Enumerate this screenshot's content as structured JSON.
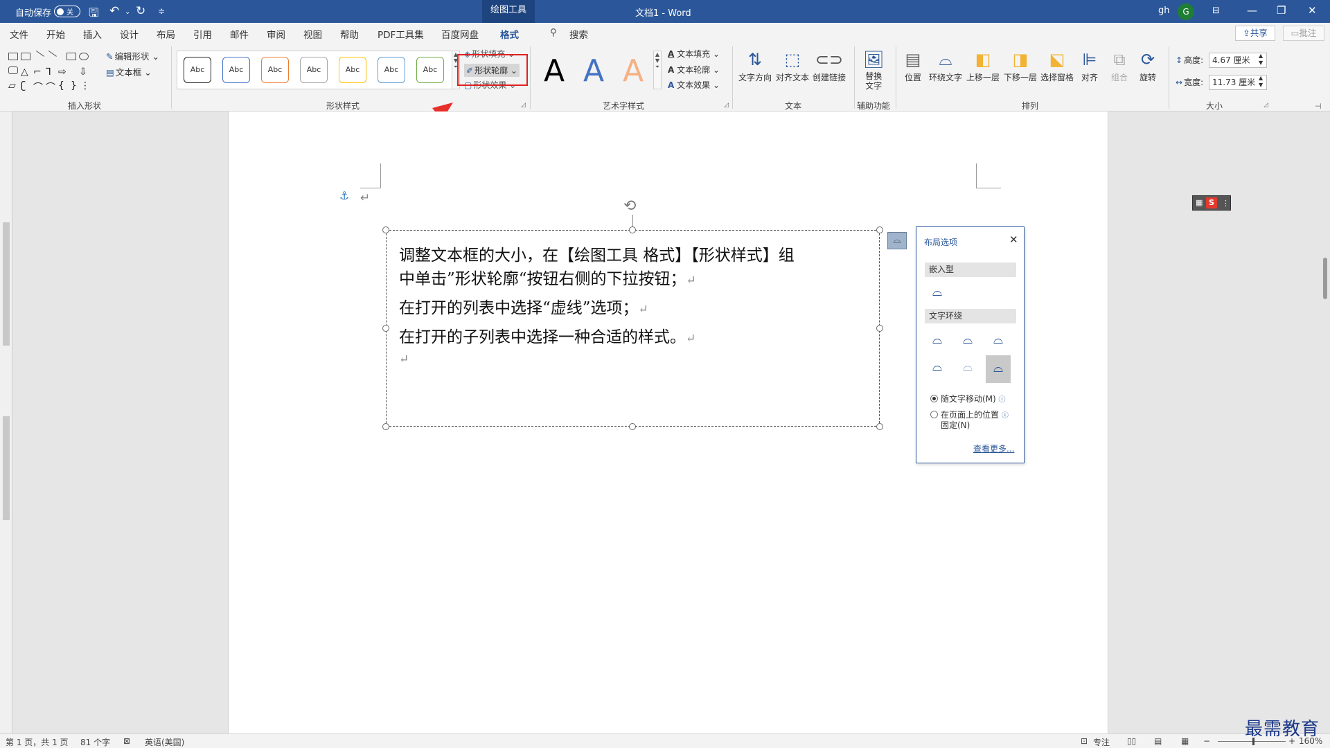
{
  "titlebar": {
    "autosave_label": "自动保存",
    "autosave_state": "关",
    "context_tab": "绘图工具",
    "doc_title": "文档1 - Word",
    "user_initials": "gh",
    "avatar_letter": "G"
  },
  "menu": {
    "tabs": [
      "文件",
      "开始",
      "插入",
      "设计",
      "布局",
      "引用",
      "邮件",
      "审阅",
      "视图",
      "帮助",
      "PDF工具集",
      "百度网盘",
      "格式"
    ],
    "active_tab": "格式",
    "search_label": "搜索",
    "share_label": "共享",
    "comment_label": "批注"
  },
  "ribbon": {
    "insert_shapes": {
      "group_label": "插入形状",
      "edit_shape": "编辑形状",
      "text_box": "文本框"
    },
    "shape_styles": {
      "group_label": "形状样式",
      "swatch_text": "Abc",
      "swatch_colors": [
        "#222222",
        "#4472c4",
        "#ed7d31",
        "#a5a5a5",
        "#ffc000",
        "#5b9bd5",
        "#70ad47"
      ],
      "shape_fill": "形状填充",
      "shape_outline": "形状轮廓",
      "shape_effect": "形状效果"
    },
    "wordart": {
      "group_label": "艺术字样式",
      "letter": "A",
      "text_fill": "文本填充",
      "text_outline": "文本轮廓",
      "text_effect": "文本效果"
    },
    "text_group": {
      "group_label": "文本",
      "text_direction": "文字方向",
      "align_text": "对齐文本",
      "create_link": "创建链接"
    },
    "accessibility": {
      "group_label": "辅助功能",
      "alt_text_line1": "替换",
      "alt_text_line2": "文字"
    },
    "arrange": {
      "group_label": "排列",
      "position": "位置",
      "wrap_text": "环绕文字",
      "bring_forward": "上移一层",
      "send_backward": "下移一层",
      "selection_pane": "选择窗格",
      "align": "对齐",
      "group": "组合",
      "rotate": "旋转"
    },
    "size": {
      "group_label": "大小",
      "height_label": "高度:",
      "height_value": "4.67 厘米",
      "width_label": "宽度:",
      "width_value": "11.73 厘米"
    }
  },
  "document": {
    "lines": [
      "调整文本框的大小，在【绘图工具  格式】【形状样式】组",
      "中单击”形状轮廓“按钮右侧的下拉按钮；",
      "在打开的列表中选择“虚线”选项；",
      "在打开的子列表中选择一种合适的样式。"
    ],
    "paragraph_mark": "↵"
  },
  "layout_panel": {
    "title": "布局选项",
    "inline_section": "嵌入型",
    "wrap_section": "文字环绕",
    "move_with_text": "随文字移动(M)",
    "fix_position_line1": "在页面上的位置",
    "fix_position_line2": "固定(N)",
    "see_more": "查看更多..."
  },
  "statusbar": {
    "page": "第 1 页，共 1 页",
    "words": "81 个字",
    "language": "英语(美国)",
    "focus": "专注",
    "zoom": "160%"
  },
  "watermark": "最需教育",
  "colors": {
    "brand": "#2b579a",
    "highlight": "#e02020"
  }
}
